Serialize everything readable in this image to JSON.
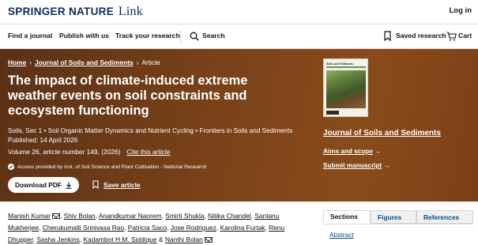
{
  "header": {
    "logo_brand": "SPRINGER NATURE",
    "logo_link": "Link",
    "login": "Log in"
  },
  "nav": {
    "find_journal": "Find a journal",
    "publish": "Publish with us",
    "track": "Track your research",
    "search": "Search",
    "saved_research": "Saved research",
    "cart": "Cart"
  },
  "breadcrumb": {
    "home": "Home",
    "journal": "Journal of Soils and Sediments",
    "article": "Article"
  },
  "article": {
    "title": "The impact of climate-induced extreme weather events on soil constraints and ecosystem functioning",
    "section": "Soils, Sec 1 • Soil Organic Matter Dynamics and Nutrient Cycling • Frontiers in Soils and Sediments",
    "published": "Published: 14 April 2026",
    "volume": "Volume 26, article number 149, (2026)",
    "cite": "Cite this article",
    "access": "Access provided by Inst. of Soil Science and Plant Cultivation - National Research",
    "download": "Download PDF",
    "save": "Save article"
  },
  "journal_panel": {
    "cover_title": "Soils and Sediments",
    "journal_name": "Journal of Soils and Sediments",
    "aims": "Aims and scope",
    "submit": "Submit manuscript"
  },
  "authors": [
    {
      "name": "Manish Kumar",
      "email": true,
      "sep": ", "
    },
    {
      "name": "Shiv Bolan",
      "sep": ", "
    },
    {
      "name": "Anandkumar Naorem",
      "sep": ", "
    },
    {
      "name": "Smirti Shukla",
      "sep": ", "
    },
    {
      "name": "Nitika Chandel",
      "sep": ", "
    },
    {
      "name": "Santanu Mukherjee",
      "sep": ", "
    },
    {
      "name": "Cherukumalli Srinivasa Rao",
      "sep": ", "
    },
    {
      "name": "Patricia Saco",
      "sep": ", "
    },
    {
      "name": "Jose Rodriguez",
      "sep": ", "
    },
    {
      "name": "Karolina Furtak",
      "sep": ", "
    },
    {
      "name": "Renu Dhupper",
      "sep": ", "
    },
    {
      "name": "Sasha Jenkins",
      "sep": ", "
    },
    {
      "name": "Kadambot H.M. Siddique",
      "sep": " & "
    },
    {
      "name": "Nanthi Bolan",
      "email": true,
      "sep": ""
    }
  ],
  "tabs": {
    "sections": "Sections",
    "figures": "Figures",
    "references": "References",
    "abstract": "Abstract"
  },
  "colors": {
    "hero": "#7a4219",
    "link": "#0a4b8c",
    "brand": "#0f2a5c"
  }
}
